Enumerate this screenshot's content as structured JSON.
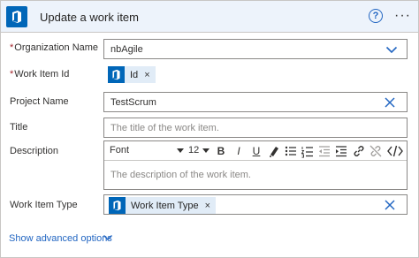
{
  "header": {
    "title": "Update a work item",
    "help_glyph": "?",
    "more_glyph": "···",
    "app_icon": "azure-devops-icon",
    "background": "#edf3fb"
  },
  "fields": {
    "organization": {
      "label": "Organization Name",
      "required": true,
      "value": "nbAgile"
    },
    "work_item_id": {
      "label": "Work Item Id",
      "required": true,
      "token": "Id",
      "token_remove": "×"
    },
    "project": {
      "label": "Project Name",
      "required": false,
      "value": "TestScrum"
    },
    "title": {
      "label": "Title",
      "required": false,
      "placeholder": "The title of the work item."
    },
    "description": {
      "label": "Description",
      "required": false,
      "placeholder": "The description of the work item.",
      "toolbar": {
        "font": "Font",
        "size": "12",
        "bold": "B",
        "italic": "I",
        "underline": "U"
      }
    },
    "work_item_type": {
      "label": "Work Item Type",
      "required": false,
      "token": "Work Item Type",
      "token_remove": "×"
    }
  },
  "required_marker": "*",
  "advanced": {
    "label": "Show advanced options"
  },
  "colors": {
    "accent": "#2266c2",
    "brand": "#0066b8",
    "required": "#a4262c"
  }
}
